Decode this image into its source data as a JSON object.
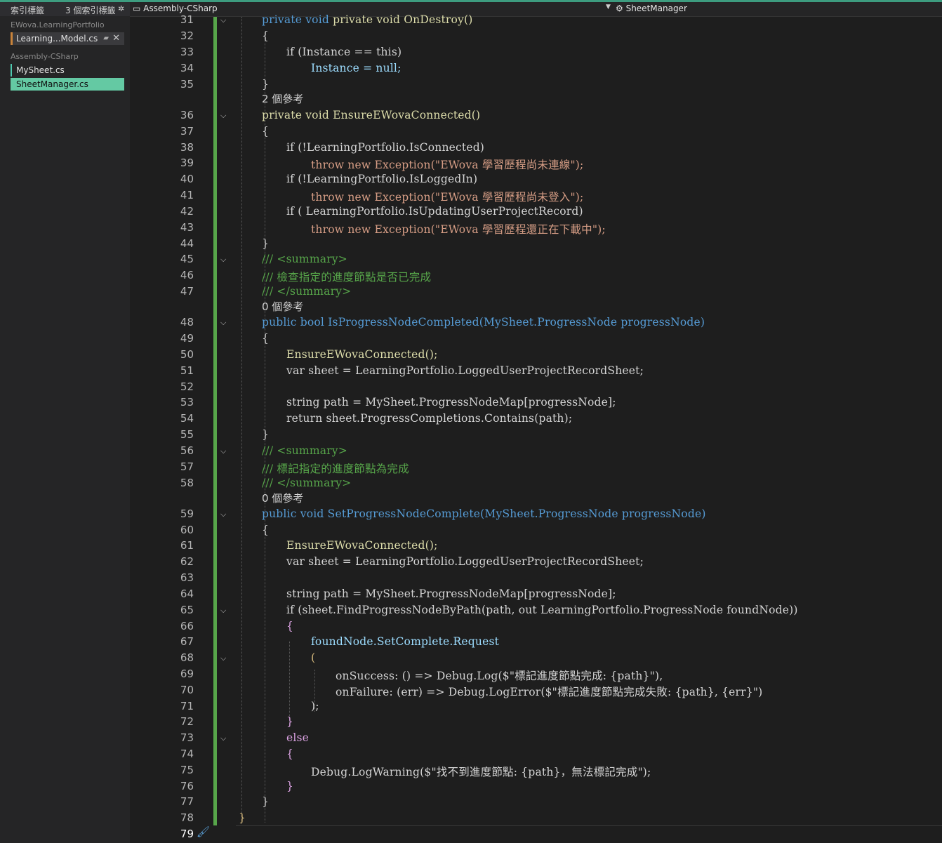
{
  "left_tabs": {
    "tab1": "索引標籤",
    "tab2": "3 個索引標籤"
  },
  "sidebar": {
    "groups": [
      {
        "name": "EWova.LearningPortfolio",
        "files": [
          "Learning...Model.cs"
        ]
      },
      {
        "name": "Assembly-CSharp",
        "files": [
          "MySheet.cs",
          "SheetManager.cs"
        ]
      }
    ],
    "active_file": "SheetManager.cs"
  },
  "navbar": {
    "project": "Assembly-CSharp",
    "class": "SheetManager"
  },
  "colors": {
    "accent": "#64c9a3",
    "change_bar": "#57a64a",
    "keyword": "#569cd6",
    "type": "#4ec9b0",
    "string": "#d69d85",
    "comment": "#57a64a"
  },
  "code": {
    "l31": "private void OnDestroy()",
    "l32": "{",
    "l33": "if (Instance == this)",
    "l34": "Instance = null;",
    "l35": "}",
    "ref36": "2 個參考",
    "l36": "private void EnsureEWovaConnected()",
    "l37": "{",
    "l38": "if (!LearningPortfolio.IsConnected)",
    "l39": "throw new Exception(\"EWova 學習歷程尚未連線\");",
    "l40": "if (!LearningPortfolio.IsLoggedIn)",
    "l41": "throw new Exception(\"EWova 學習歷程尚未登入\");",
    "l42": "if ( LearningPortfolio.IsUpdatingUserProjectRecord)",
    "l43": "throw new Exception(\"EWova 學習歷程還正在下載中\");",
    "l44": "}",
    "l45": "/// <summary>",
    "l46": "/// 檢查指定的進度節點是否已完成",
    "l47": "/// </summary>",
    "ref48": "0 個參考",
    "l48": "public bool IsProgressNodeCompleted(MySheet.ProgressNode progressNode)",
    "l49": "{",
    "l50": "EnsureEWovaConnected();",
    "l51": "var sheet = LearningPortfolio.LoggedUserProjectRecordSheet;",
    "l53": "string path = MySheet.ProgressNodeMap[progressNode];",
    "l54": "return sheet.ProgressCompletions.Contains(path);",
    "l55": "}",
    "l56": "/// <summary>",
    "l57": "/// 標記指定的進度節點為完成",
    "l58": "/// </summary>",
    "ref59": "0 個參考",
    "l59": "public void SetProgressNodeComplete(MySheet.ProgressNode progressNode)",
    "l60": "{",
    "l61": "EnsureEWovaConnected();",
    "l62": "var sheet = LearningPortfolio.LoggedUserProjectRecordSheet;",
    "l64": "string path = MySheet.ProgressNodeMap[progressNode];",
    "l65": "if (sheet.FindProgressNodeByPath(path, out LearningPortfolio.ProgressNode foundNode))",
    "l66": "{",
    "l67": "foundNode.SetComplete.Request",
    "l68": "(",
    "l69": "onSuccess: () => Debug.Log($\"標記進度節點完成: {path}\"),",
    "l70": "onFailure: (err) => Debug.LogError($\"標記進度節點完成失敗: {path}, {err}\")",
    "l71": ");",
    "l72": "}",
    "l73": "else",
    "l74": "{",
    "l75": "Debug.LogWarning($\"找不到進度節點: {path}，無法標記完成\");",
    "l76": "}",
    "l77": "}",
    "l78": "}"
  }
}
